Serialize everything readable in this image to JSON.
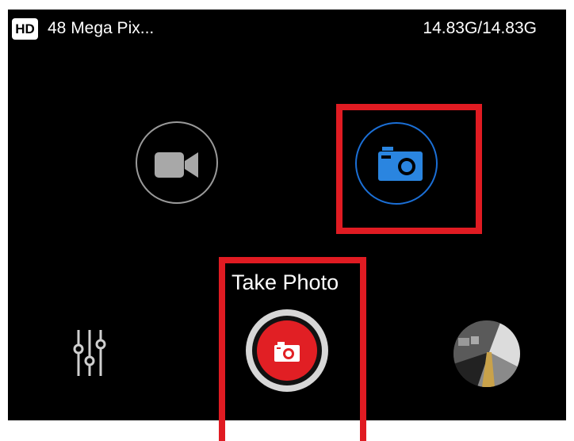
{
  "status_bar": {
    "quality_badge": "HD",
    "resolution_label": "48 Mega Pix...",
    "storage_label": "14.83G/14.83G"
  },
  "modes": {
    "video": {
      "icon": "video-camera-icon",
      "selected": false
    },
    "photo": {
      "icon": "camera-icon",
      "selected": true,
      "color": "#1b6fd6"
    }
  },
  "shutter": {
    "label": "Take Photo",
    "icon": "camera-icon",
    "color": "#e11f24"
  },
  "controls": {
    "settings_icon": "sliders-icon",
    "gallery_icon": "gallery-thumbnail"
  },
  "annotation_color": "#e01b22"
}
